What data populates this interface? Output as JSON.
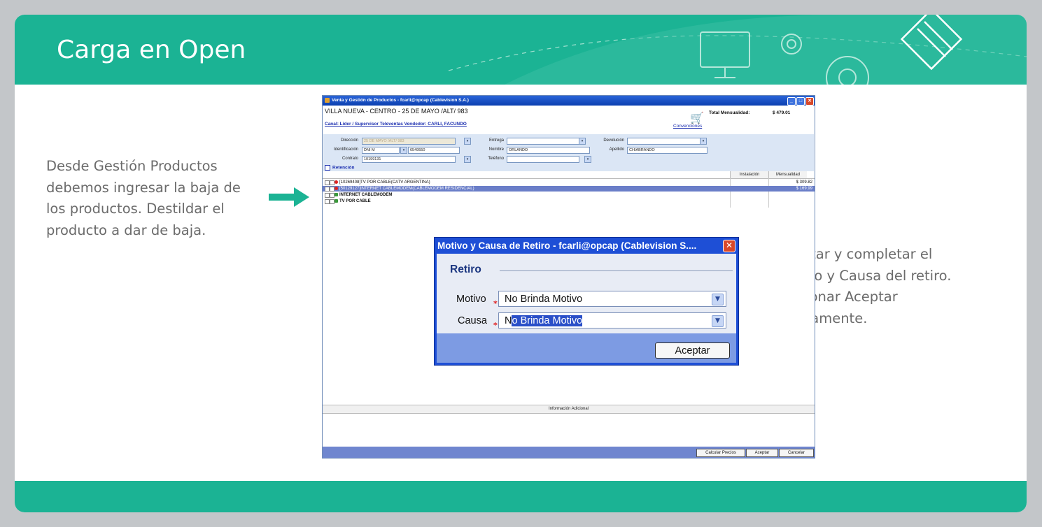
{
  "slide": {
    "title": "Carga en Open",
    "left_note": "Desde Gestión Productos debemos ingresar la baja de los productos. Destildar el producto a dar de baja.",
    "right_note": "Aceptar y completar el Motivo y Causa del retiro. Presionar Aceptar nuevamente.",
    "accent_color": "#1bb394"
  },
  "app": {
    "window_title": "Venta y Gestión de Productos - fcarli@opcap (Cablevision S.A.)",
    "address": "VILLA NUEVA - CENTRO - 25 DE MAYO /ALT/ 983",
    "canal": "Canal: Lider / Supervisor Televentas Vendedor: CARLI, FACUNDO",
    "total_label": "Total Mensualidad:",
    "total_value": "$ 479.01",
    "conventions_link": "Convenciones",
    "form": {
      "direccion_label": "Dirección",
      "direccion_value": "25 DE MAYO /ALT/ 983",
      "identificacion_label": "Identificación",
      "id_type": "DNI M",
      "id_number": "6549550",
      "contrato_label": "Contrato",
      "contrato_value": "10199131",
      "entrega_label": "Entrega",
      "nombre_label": "Nombre",
      "nombre_value": "ORLANDO",
      "telefono_label": "Teléfono",
      "devolucion_label": "Devolución",
      "apellido_label": "Apellido",
      "apellido_value": "CHIABRANDO"
    },
    "retencion_label": "Retención",
    "grid": {
      "col_instalacion": "Instalación",
      "col_mensualidad": "Mensualidad",
      "rows": [
        {
          "label": "[10269408]TV POR CABLE(CATV ARGENTINA)",
          "mensualidad": "$ 309.82"
        },
        {
          "label": "[50129127]INTERNET CABLEMODEM(CABLEMODEM RESIDENCIAL)",
          "mensualidad": "$ 169.99"
        },
        {
          "label": "INTERNET CABLEMODEM",
          "mensualidad": ""
        },
        {
          "label": "TV POR CABLE",
          "mensualidad": ""
        }
      ]
    },
    "info_label": "Información Adicional",
    "buttons": {
      "calcular": "Calcular Precios",
      "aceptar": "Aceptar",
      "cancelar": "Cancelar"
    }
  },
  "dialog": {
    "title": "Motivo y Causa de Retiro - fcarli@opcap (Cablevision S....",
    "section": "Retiro",
    "motivo_label": "Motivo",
    "motivo_value": "No Brinda Motivo",
    "causa_label": "Causa",
    "causa_value_first": "N",
    "causa_value_rest": "o Brinda Motivo",
    "accept_label": "Aceptar"
  }
}
